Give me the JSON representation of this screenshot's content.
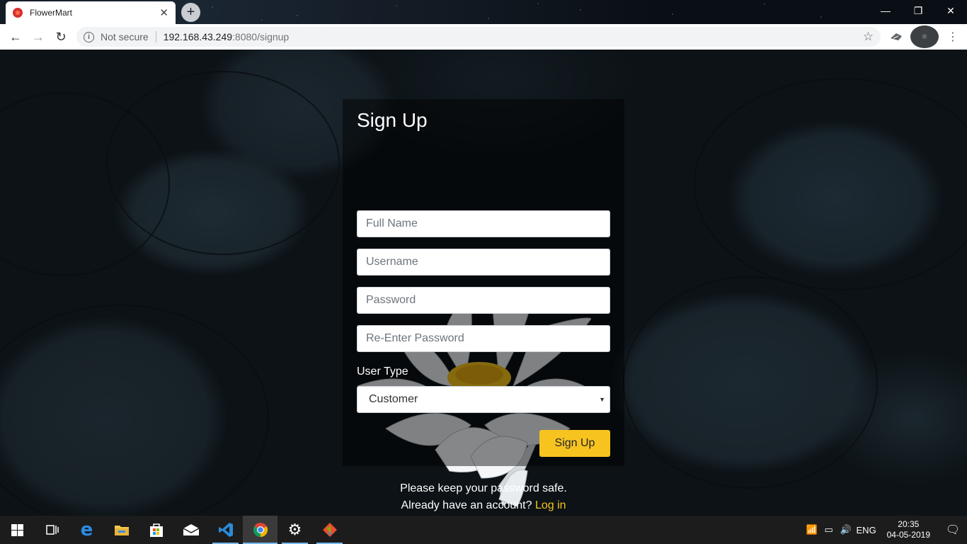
{
  "browser": {
    "tab_title": "FlowerMart",
    "tab_close": "✕",
    "new_tab": "+",
    "window_controls": {
      "minimize": "—",
      "restore": "❐",
      "close": "✕"
    },
    "nav": {
      "back": "←",
      "forward": "→",
      "reload": "↻"
    },
    "security_text": "Not secure",
    "url_host": "192.168.43.249",
    "url_path": ":8080/signup",
    "icons": [
      "info-icon",
      "star-icon",
      "extension-icon",
      "profile-icon",
      "menu-icon"
    ]
  },
  "signup": {
    "title": "Sign Up",
    "full_name_placeholder": "Full Name",
    "username_placeholder": "Username",
    "password_placeholder": "Password",
    "reenter_password_placeholder": "Re-Enter Password",
    "user_type_label": "User Type",
    "user_type_selected": "Customer",
    "submit_label": "Sign Up",
    "note": "Please keep your password safe.",
    "account_prompt": "Already have an account? ",
    "login_link": "Log in",
    "accent_color": "#f7c31f"
  },
  "taskbar": {
    "apps": [
      "windows-start",
      "task-view",
      "edge",
      "file-explorer",
      "store",
      "mail",
      "vscode",
      "chrome",
      "settings",
      "git"
    ],
    "language": "ENG",
    "time": "20:35",
    "date": "04-05-2019"
  }
}
